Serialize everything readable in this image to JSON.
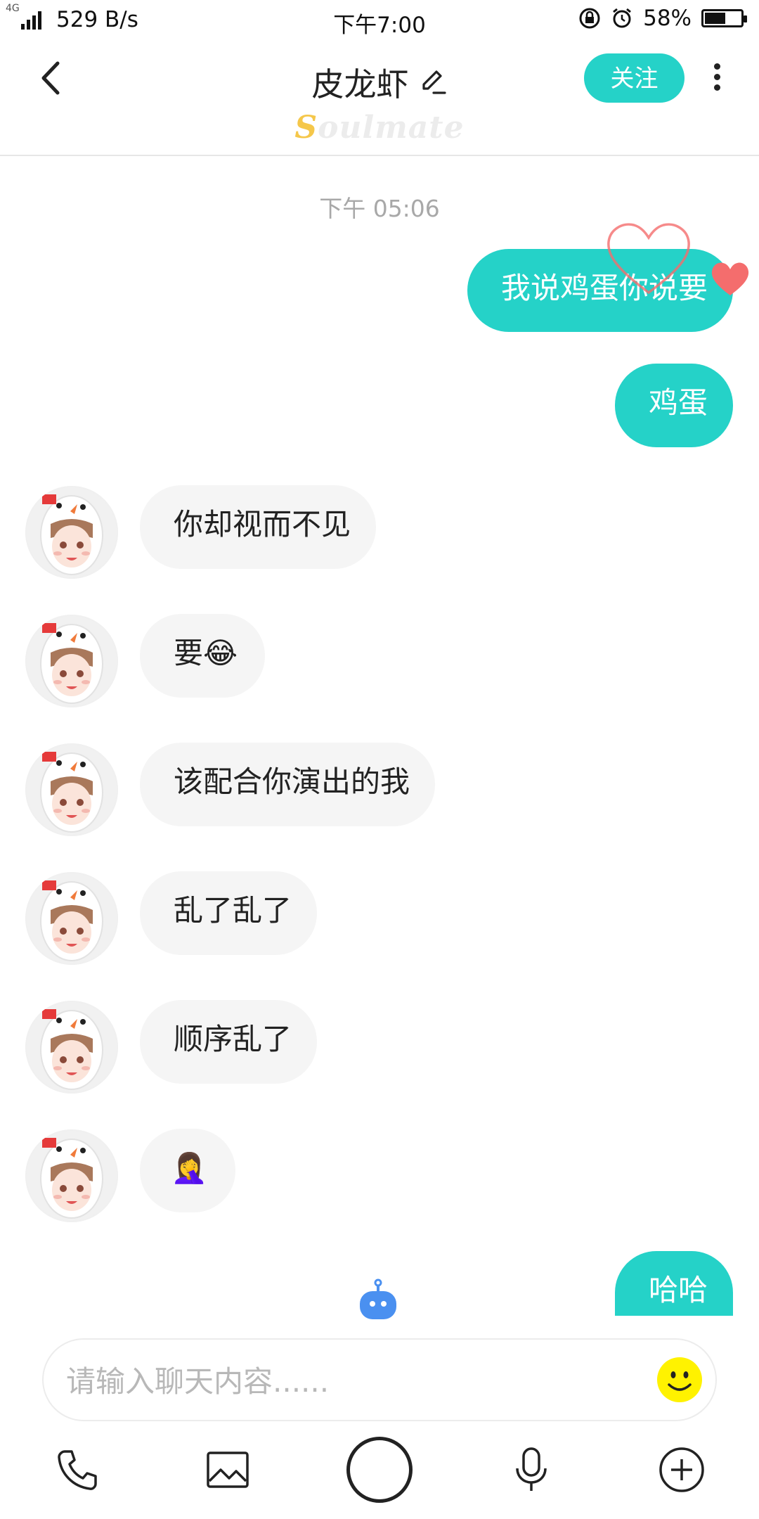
{
  "status_bar": {
    "network": "4G",
    "speed": "529 B/s",
    "time": "下午7:00",
    "battery": "58%",
    "battery_level": 0.58
  },
  "header": {
    "title": "皮龙虾",
    "follow_label": "关注",
    "brand": "Soulmate",
    "brand_first": "S",
    "brand_rest": "oulmate"
  },
  "chat": {
    "timestamp": "下午 05:06",
    "messages": [
      {
        "side": "out",
        "text": "我说鸡蛋你说要"
      },
      {
        "side": "out",
        "text": "鸡蛋"
      },
      {
        "side": "in",
        "text": "你却视而不见"
      },
      {
        "side": "in",
        "text": "要😂"
      },
      {
        "side": "in",
        "text": "该配合你演出的我"
      },
      {
        "side": "in",
        "text": "乱了乱了"
      },
      {
        "side": "in",
        "text": "顺序乱了"
      },
      {
        "side": "in",
        "text": "🤦‍♀️"
      },
      {
        "side": "out",
        "text": "哈哈"
      }
    ]
  },
  "input": {
    "placeholder": "请输入聊天内容......",
    "value": ""
  },
  "toolbar": {
    "icons": [
      "phone-icon",
      "image-icon",
      "record-button",
      "microphone-icon",
      "plus-icon"
    ]
  },
  "colors": {
    "accent": "#25d2c8",
    "incoming_bubble": "#f5f5f5",
    "brand_yellow": "#f5c74a",
    "heart": "#f46d6d",
    "bot": "#4a90f0"
  }
}
